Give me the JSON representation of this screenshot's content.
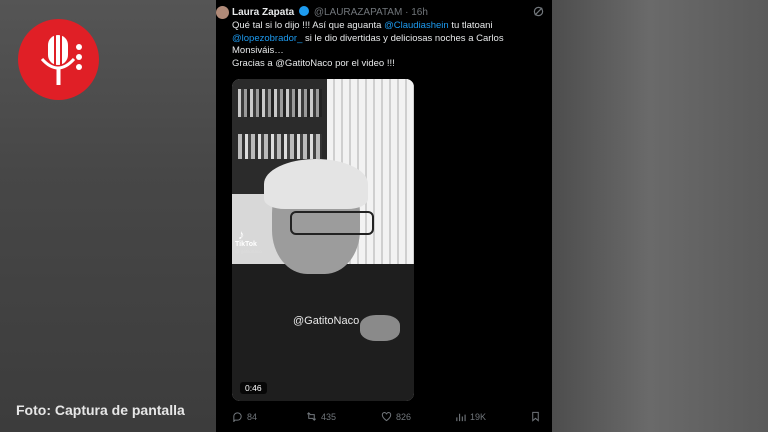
{
  "background": {
    "caption": "Foto: Captura de pantalla",
    "logo_icon": "microphone-icon",
    "logo_color": "#e01f26"
  },
  "tweet": {
    "author_name": "Laura Zapata",
    "handle": "@LAURAZAPATAM",
    "separator": "·",
    "time": "16h",
    "text": {
      "t1": "Qué tal si lo dijo !!! Así que aguanta ",
      "m1": "@Claudiashein",
      "t2": " tu tlatoani",
      "m2": "@lopezobrador_",
      "t3": " si le dio divertidas y deliciosas noches a Carlos Monsiváis…",
      "t4": "Gracias a @GatitoNaco por el video !!!"
    },
    "media": {
      "tiktok_label": "TikTok",
      "tiktok_handle": "@ gatitonaco",
      "watermark": "@GatitoNaco",
      "duration": "0:46"
    },
    "actions": {
      "replies": "84",
      "reposts": "435",
      "likes": "826",
      "views": "19K"
    },
    "colors": {
      "mention": "#1d9bf0",
      "muted": "#71767b",
      "text": "#e7e9ea"
    }
  }
}
